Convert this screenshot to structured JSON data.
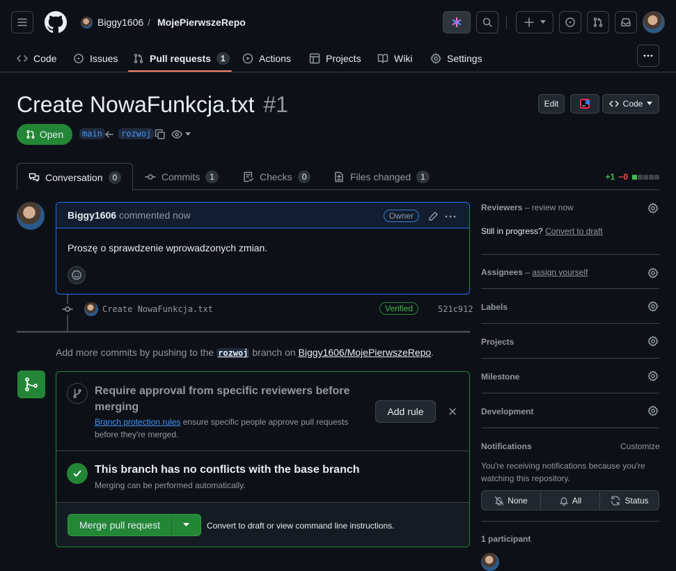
{
  "header": {
    "owner": "Biggy1606",
    "separator": "/",
    "repo": "MojePierwszeRepo"
  },
  "nav": {
    "code": "Code",
    "issues": "Issues",
    "pull_requests": "Pull requests",
    "pull_requests_count": "1",
    "actions": "Actions",
    "projects": "Projects",
    "wiki": "Wiki",
    "settings": "Settings"
  },
  "pr": {
    "title": "Create NowaFunkcja.txt",
    "number": "#1",
    "state": "Open",
    "base_branch": "main",
    "head_branch": "rozwoj",
    "edit_label": "Edit",
    "code_label": "Code"
  },
  "tabs": [
    {
      "label": "Conversation",
      "count": "0"
    },
    {
      "label": "Commits",
      "count": "1"
    },
    {
      "label": "Checks",
      "count": "0"
    },
    {
      "label": "Files changed",
      "count": "1"
    }
  ],
  "diffstat": {
    "added": "+1",
    "removed": "−0"
  },
  "comment": {
    "author": "Biggy1606",
    "meta": "commented now",
    "role_badge": "Owner",
    "body": "Proszę o sprawdzenie wprowadzonych zmian."
  },
  "commit": {
    "message": "Create NowaFunkcja.txt",
    "badge": "Verified",
    "sha": "521c912"
  },
  "push_hint": {
    "prefix": "Add more commits by pushing to the",
    "branch": "rozwoj",
    "middle": "branch on",
    "repo_link": "Biggy1606/MojePierwszeRepo",
    "suffix": "."
  },
  "merge_box": {
    "rule_title": "Require approval from specific reviewers before merging",
    "rule_link": "Branch protection rules",
    "rule_desc": "ensure specific people approve pull requests before they're merged.",
    "add_rule_label": "Add rule",
    "conflict_title": "This branch has no conflicts with the base branch",
    "conflict_desc": "Merging can be performed automatically.",
    "merge_button": "Merge pull request",
    "convert_link": "Convert to draft",
    "or_view": "or view",
    "cli_link": "command line instructions",
    "period": "."
  },
  "sidebar": {
    "reviewers_label": "Reviewers",
    "reviewers_dash": "–",
    "reviewers_action": "review now",
    "still_progress": "Still in progress?",
    "convert_draft": "Convert to draft",
    "assignees_label": "Assignees",
    "assignees_dash": "–",
    "assignees_action": "assign yourself",
    "labels": "Labels",
    "projects": "Projects",
    "milestone": "Milestone",
    "development": "Development",
    "notifications": "Notifications",
    "customize": "Customize",
    "notif_desc": "You're receiving notifications because you're watching this repository.",
    "notif_none": "None",
    "notif_all": "All",
    "notif_status": "Status",
    "participants": "1 participant"
  },
  "colors": {
    "accent": "#4493f8",
    "success": "#238636",
    "success_fg": "#3fb950",
    "danger_fg": "#f85149",
    "border": "#3d444d",
    "bg": "#0d1117"
  }
}
